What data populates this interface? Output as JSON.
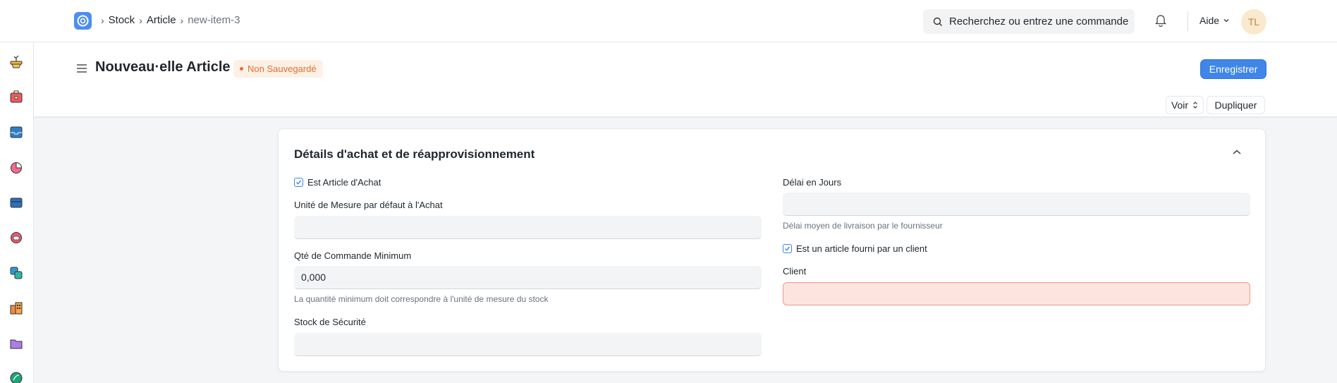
{
  "navbar": {
    "breadcrumbs": [
      "Stock",
      "Article",
      "new-item-3"
    ],
    "search_placeholder": "Recherchez ou entrez une commande",
    "help_label": "Aide",
    "avatar_initials": "TL"
  },
  "rail": {
    "icons": [
      "plant-icon",
      "toolbox-icon",
      "inbox-icon",
      "pie-chart-icon",
      "wallet-icon",
      "headset-icon",
      "shapes-icon",
      "building-icon",
      "folder-icon",
      "leaf-icon"
    ]
  },
  "page": {
    "title": "Nouveau·elle Article",
    "status_badge": "Non Sauvegardé",
    "save_label": "Enregistrer",
    "view_label": "Voir",
    "duplicate_label": "Dupliquer"
  },
  "section": {
    "title": "Détails d'achat et de réapprovisionnement",
    "left": {
      "is_purchase_item": {
        "label": "Est Article d'Achat",
        "checked": true
      },
      "purchase_uom": {
        "label": "Unité de Mesure par défaut à l'Achat",
        "value": ""
      },
      "min_order_qty": {
        "label": "Qté de Commande Minimum",
        "value": "0,000",
        "help": "La quantité minimum doit correspondre à l'unité de mesure du stock"
      },
      "safety_stock": {
        "label": "Stock de Sécurité",
        "value": ""
      }
    },
    "right": {
      "lead_time_days": {
        "label": "Délai en Jours",
        "value": "",
        "help": "Délai moyen de livraison par le fournisseur"
      },
      "is_customer_provided": {
        "label": "Est un article fourni par un client",
        "checked": true
      },
      "customer": {
        "label": "Client",
        "value": ""
      }
    }
  },
  "colors": {
    "primary": "#3f86e8",
    "unsaved": "#e86c32",
    "error_bg": "#fde4de"
  }
}
